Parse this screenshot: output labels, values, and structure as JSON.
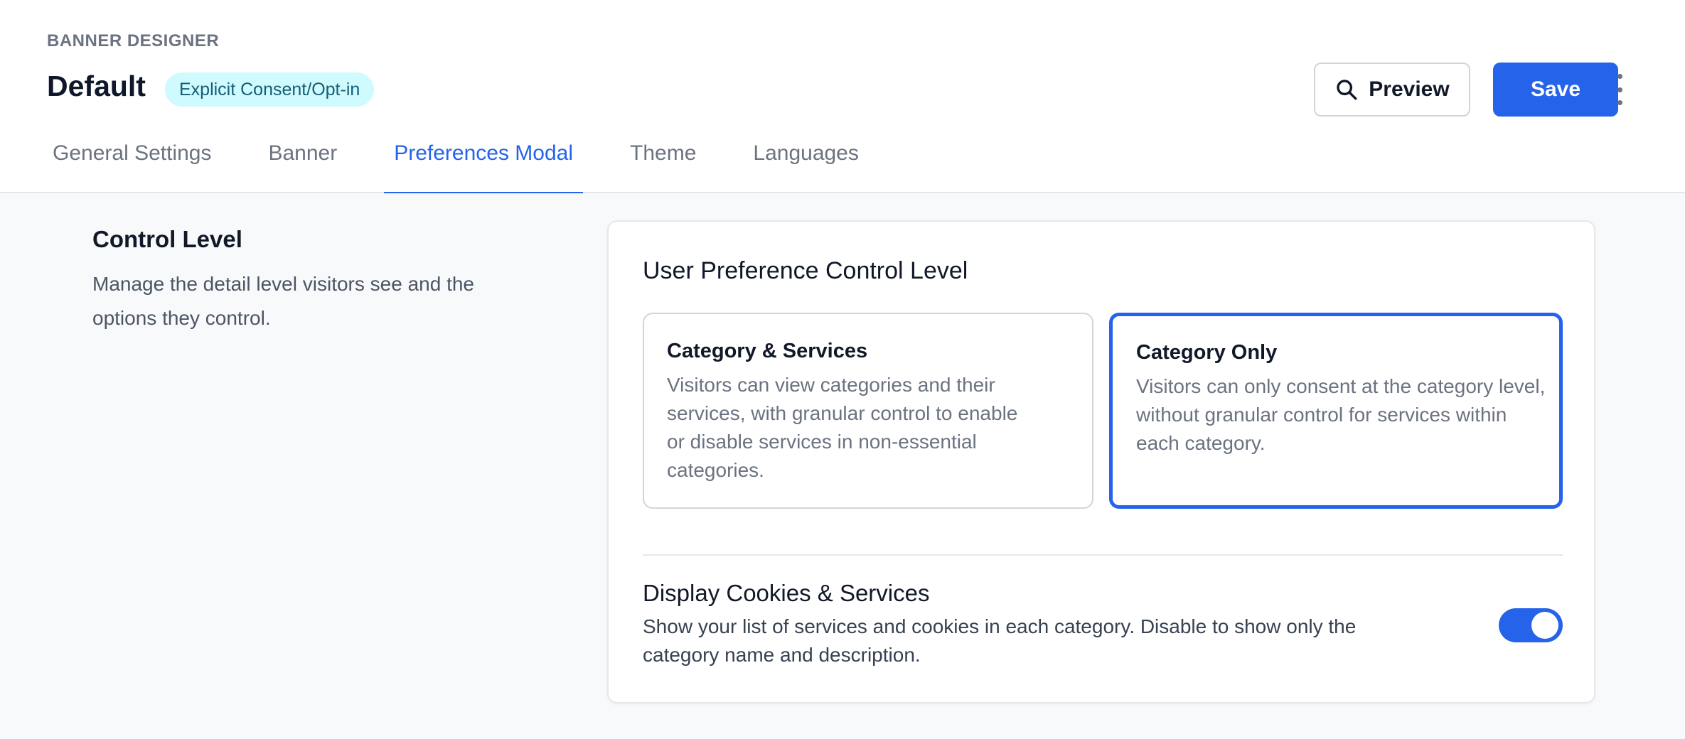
{
  "header": {
    "eyebrow": "BANNER DESIGNER",
    "title": "Default",
    "badge": "Explicit Consent/Opt-in",
    "preview_label": "Preview",
    "save_label": "Save"
  },
  "tabs": [
    {
      "label": "General Settings",
      "active": false
    },
    {
      "label": "Banner",
      "active": false
    },
    {
      "label": "Preferences Modal",
      "active": true
    },
    {
      "label": "Theme",
      "active": false
    },
    {
      "label": "Languages",
      "active": false
    }
  ],
  "section": {
    "title": "Control Level",
    "description": "Manage the detail level visitors see and the options they control."
  },
  "card": {
    "title": "User Preference Control Level",
    "options": [
      {
        "title": "Category & Services",
        "description": "Visitors can view categories and their services, with granular control to enable or disable services in non-essential categories.",
        "selected": false
      },
      {
        "title": "Category Only",
        "description": "Visitors can only consent at the category level, without granular control for services within each category.",
        "selected": true
      }
    ],
    "toggle": {
      "title": "Display Cookies & Services",
      "description": "Show your list of services and cookies in each category. Disable to show only the category name and description.",
      "enabled": true
    }
  },
  "colors": {
    "accent": "#2563eb",
    "badge_bg": "#cffafe",
    "badge_text": "#155e75"
  },
  "icons": {
    "preview": "search-icon",
    "menu": "more-vertical-icon"
  }
}
